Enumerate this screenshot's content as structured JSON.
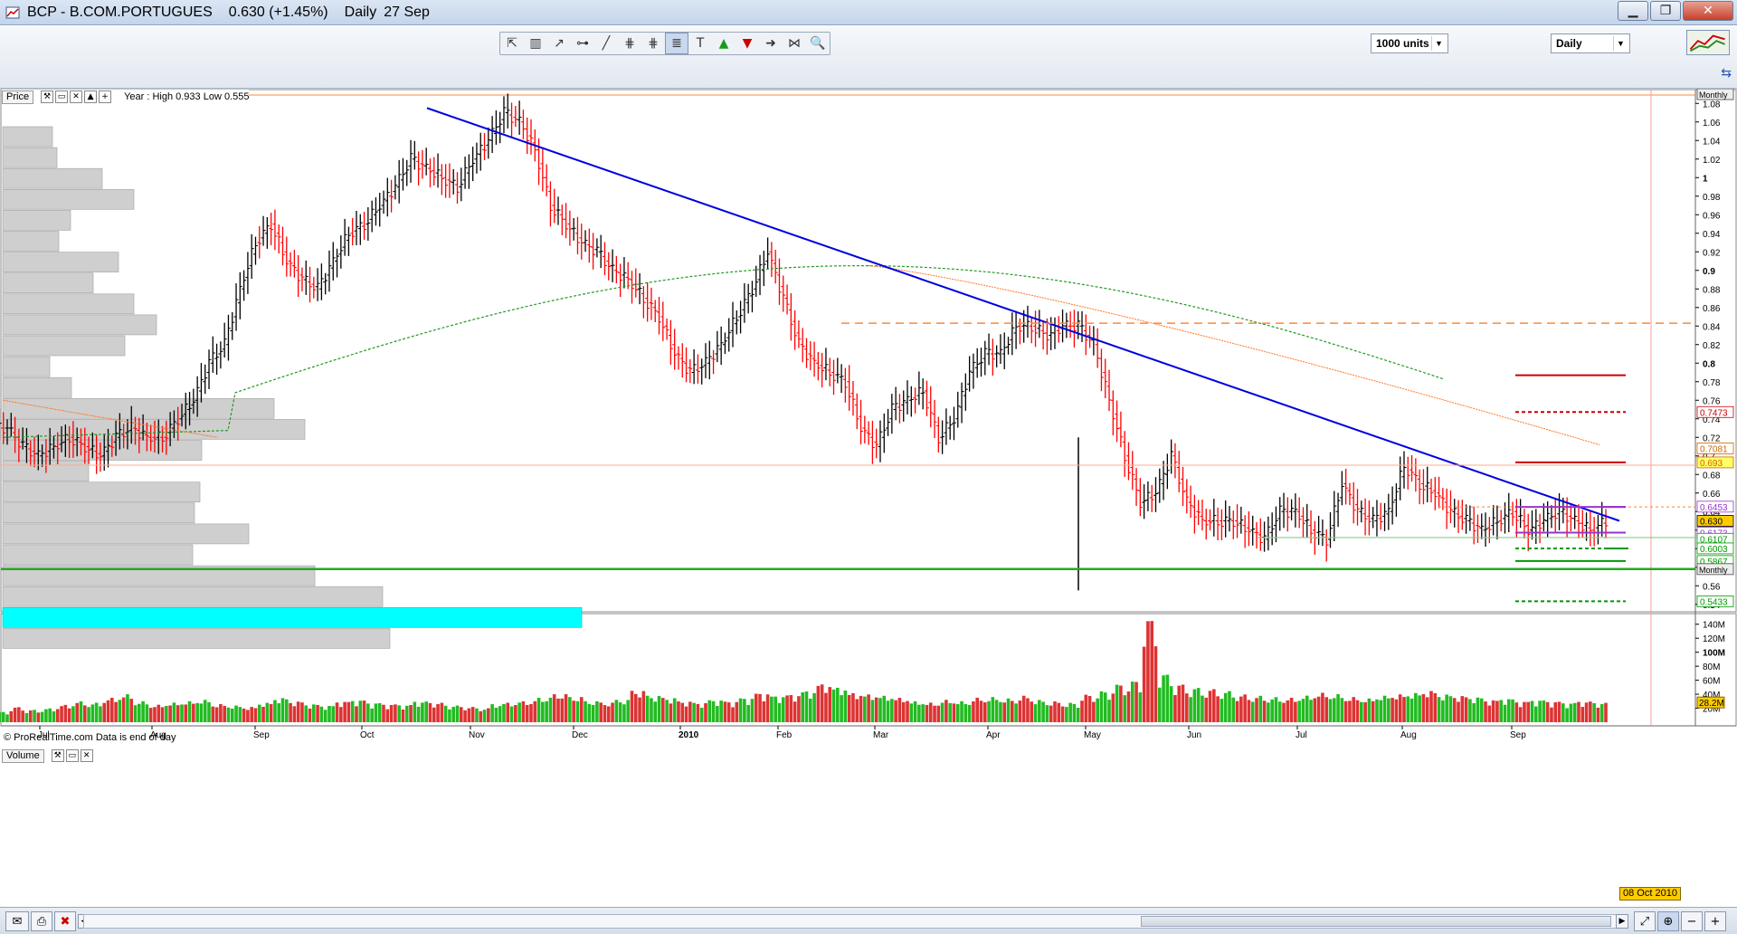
{
  "window": {
    "title": "BCP - B.COM.PORTUGUES",
    "quote": "0.630 (+1.45%)",
    "period": "Daily",
    "date": "27 Sep",
    "min_glyph": "▁",
    "max_glyph": "❐",
    "close_glyph": "✕"
  },
  "toolbar": {
    "tool_glyphs": [
      "⇱",
      "▥",
      "↗",
      "⊶",
      "╱",
      "⋕",
      "⋕",
      "≣",
      "T",
      "▲",
      "▼",
      "➜",
      "⋈",
      "🔍"
    ],
    "tool_names": [
      "pointer-icon",
      "ruler-icon",
      "trend-arrow-icon",
      "horizontal-line-icon",
      "trendline-icon",
      "fibonacci-icon",
      "fan-icon",
      "channel-icon",
      "text-tool-icon",
      "buy-arrow-icon",
      "sell-arrow-icon",
      "arrow-tool-icon",
      "pattern-icon",
      "zoom-icon"
    ],
    "units_label": "1000 units",
    "timeframe_label": "Daily"
  },
  "price_panel": {
    "label": "Price",
    "info": "Year : High 0.933 Low 0.555",
    "footer": "© ProRealTime.com  Data is end of day",
    "monthly_tag": "Monthly",
    "monthly_tag2": "Monthly",
    "y_ticks": [
      "1.08",
      "1.06",
      "1.04",
      "1.02",
      "1",
      "0.98",
      "0.96",
      "0.94",
      "0.92",
      "0.9",
      "0.88",
      "0.86",
      "0.84",
      "0.82",
      "0.8",
      "0.78",
      "0.76",
      "0.74",
      "0.72",
      "0.7",
      "0.68",
      "0.66",
      "0.64",
      "0.62",
      "0.6",
      "0.58",
      "0.56",
      "0.54"
    ],
    "bold_ticks": [
      "1",
      "0.9",
      "0.8"
    ],
    "value_tags": [
      {
        "text": "0.7473",
        "color": "#cc0000",
        "value": 0.7473
      },
      {
        "text": "0.7081",
        "color": "#cc6600",
        "value": 0.7081
      },
      {
        "text": "0.693",
        "color": "#cc6600",
        "value": 0.693,
        "bg": "#ffff66"
      },
      {
        "text": "0.6453",
        "color": "#9933cc",
        "value": 0.6453
      },
      {
        "text": "0.630",
        "color": "#000000",
        "value": 0.63,
        "bg": "#ffcc00"
      },
      {
        "text": "0.6173",
        "color": "#9933cc",
        "value": 0.6173
      },
      {
        "text": "0.6107",
        "color": "#009900",
        "value": 0.6107
      },
      {
        "text": "0.6003",
        "color": "#009900",
        "value": 0.6003
      },
      {
        "text": "0.5867",
        "color": "#009900",
        "value": 0.5867
      },
      {
        "text": "0.5433",
        "color": "#009900",
        "value": 0.5433
      }
    ]
  },
  "volume_panel": {
    "label": "Volume",
    "y_ticks": [
      "140M",
      "120M",
      "100M",
      "80M",
      "60M",
      "40M",
      "20M"
    ],
    "bold_ticks": [
      "100M"
    ],
    "last_tag": "28.2M"
  },
  "x_axis": {
    "labels": [
      {
        "text": "Jul",
        "bold": false
      },
      {
        "text": "Aug",
        "bold": false
      },
      {
        "text": "Sep",
        "bold": false
      },
      {
        "text": "Oct",
        "bold": false
      },
      {
        "text": "Nov",
        "bold": false
      },
      {
        "text": "Dec",
        "bold": false
      },
      {
        "text": "2010",
        "bold": true
      },
      {
        "text": "Feb",
        "bold": false
      },
      {
        "text": "Mar",
        "bold": false
      },
      {
        "text": "Apr",
        "bold": false
      },
      {
        "text": "May",
        "bold": false
      },
      {
        "text": "Jun",
        "bold": false
      },
      {
        "text": "Jul",
        "bold": false
      },
      {
        "text": "Aug",
        "bold": false
      },
      {
        "text": "Sep",
        "bold": false
      }
    ],
    "cursor_date": "08 Oct 2010"
  },
  "colors": {
    "up_bar": "#000000",
    "down_bar": "#ff0000",
    "trendline": "#0000dd",
    "ma_green": "#229922",
    "ma_orange": "#ff7722",
    "support": "#22aa22",
    "profile_bar": "#cfcfcf",
    "profile_poc": "#00ffff",
    "vol_up": "#22bb22",
    "vol_down": "#dd3333"
  },
  "chart_data": {
    "type": "candlestick",
    "symbol": "BCP - B.COM.PORTUGUES",
    "timeframe": "Daily",
    "last_price": 0.63,
    "change_pct": 1.45,
    "year_high": 0.933,
    "year_low": 0.555,
    "ylim": [
      0.53,
      1.09
    ],
    "closes": [
      0.73,
      0.71,
      0.7,
      0.71,
      0.72,
      0.71,
      0.7,
      0.72,
      0.73,
      0.72,
      0.72,
      0.74,
      0.76,
      0.8,
      0.82,
      0.88,
      0.93,
      0.95,
      0.91,
      0.89,
      0.88,
      0.91,
      0.94,
      0.95,
      0.97,
      0.99,
      1.02,
      1.01,
      1.0,
      0.99,
      1.02,
      1.04,
      1.07,
      1.06,
      1.03,
      0.97,
      0.95,
      0.93,
      0.92,
      0.9,
      0.89,
      0.87,
      0.85,
      0.81,
      0.79,
      0.8,
      0.82,
      0.85,
      0.88,
      0.92,
      0.87,
      0.82,
      0.8,
      0.79,
      0.78,
      0.73,
      0.71,
      0.75,
      0.76,
      0.77,
      0.72,
      0.74,
      0.79,
      0.81,
      0.81,
      0.84,
      0.84,
      0.83,
      0.84,
      0.84,
      0.82,
      0.76,
      0.7,
      0.65,
      0.66,
      0.7,
      0.65,
      0.63,
      0.63,
      0.63,
      0.62,
      0.61,
      0.64,
      0.64,
      0.62,
      0.61,
      0.67,
      0.64,
      0.63,
      0.64,
      0.69,
      0.67,
      0.66,
      0.64,
      0.63,
      0.62,
      0.63,
      0.64,
      0.62,
      0.63,
      0.64,
      0.63,
      0.62,
      0.63
    ],
    "trendline": {
      "from": {
        "date": "Oct 2009",
        "value": 1.075
      },
      "to": {
        "date": "Sep 2010",
        "value": 0.63
      }
    },
    "horizontal_levels": [
      {
        "value": 0.843,
        "style": "dashed",
        "color": "#ff8833"
      },
      {
        "value": 0.69,
        "style": "solid",
        "color": "#ffaa88"
      },
      {
        "value": 0.645,
        "style": "dashed",
        "color": "#ff8833"
      },
      {
        "value": 0.612,
        "style": "solid",
        "color": "#22aa22"
      },
      {
        "value": 0.578,
        "style": "solid",
        "color": "#22aa22"
      }
    ],
    "target_levels": [
      {
        "value": 0.787,
        "style": "solid",
        "color": "#cc0000"
      },
      {
        "value": 0.7473,
        "style": "dashed",
        "color": "#cc0000"
      },
      {
        "value": 0.693,
        "style": "solid",
        "color": "#cc0000"
      },
      {
        "value": 0.645,
        "style": "solid",
        "color": "#9933cc"
      },
      {
        "value": 0.6173,
        "style": "solid",
        "color": "#9933cc"
      },
      {
        "value": 0.6003,
        "style": "dashed",
        "color": "#009900"
      },
      {
        "value": 0.5867,
        "style": "solid",
        "color": "#009900"
      },
      {
        "value": 0.5433,
        "style": "dashed",
        "color": "#009900"
      }
    ],
    "volume_profile_widths": [
      55,
      60,
      110,
      145,
      75,
      62,
      128,
      100,
      145,
      170,
      135,
      52,
      76,
      300,
      334,
      220,
      95,
      218,
      212,
      272,
      210,
      345,
      420,
      640,
      428
    ],
    "volume_profile_poc_index": 23,
    "volume": [
      15,
      22,
      18,
      20,
      25,
      30,
      28,
      35,
      40,
      30,
      25,
      28,
      30,
      32,
      26,
      24,
      22,
      28,
      35,
      30,
      26,
      24,
      30,
      32,
      28,
      26,
      25,
      30,
      28,
      24,
      22,
      20,
      26,
      28,
      30,
      35,
      40,
      36,
      30,
      28,
      32,
      45,
      38,
      35,
      30,
      28,
      32,
      30,
      35,
      42,
      38,
      40,
      45,
      55,
      50,
      42,
      40,
      38,
      35,
      30,
      28,
      32,
      30,
      35,
      36,
      34,
      38,
      32,
      30,
      28,
      40,
      45,
      55,
      60,
      150,
      70,
      55,
      50,
      48,
      45,
      40,
      38,
      36,
      35,
      38,
      42,
      40,
      36,
      34,
      38,
      40,
      42,
      45,
      40,
      38,
      36,
      32,
      34,
      30,
      32,
      30,
      28,
      30,
      28
    ],
    "volume_up": [
      true,
      false,
      true,
      true,
      false,
      true,
      true,
      false,
      true,
      true,
      false,
      true,
      true,
      true,
      false,
      true,
      false,
      true,
      true,
      false,
      true,
      true,
      false,
      true,
      true,
      false,
      true,
      true,
      false,
      true,
      false,
      true,
      true,
      false,
      false,
      true,
      false,
      true,
      true,
      false,
      true,
      false,
      true,
      false,
      false,
      true,
      true,
      false,
      true,
      false,
      true,
      false,
      true,
      false,
      true,
      false,
      true,
      true,
      false,
      true,
      false,
      true,
      true,
      false,
      true,
      false,
      false,
      true,
      false,
      true,
      false,
      true,
      false,
      false,
      false,
      true,
      false,
      true,
      false,
      true,
      false,
      true,
      true,
      false,
      true,
      false,
      true,
      false,
      true,
      true,
      false,
      true,
      false,
      true,
      false,
      true,
      false,
      true,
      false,
      true,
      false,
      true,
      false,
      true
    ],
    "volume_ylim": [
      0,
      150
    ]
  }
}
